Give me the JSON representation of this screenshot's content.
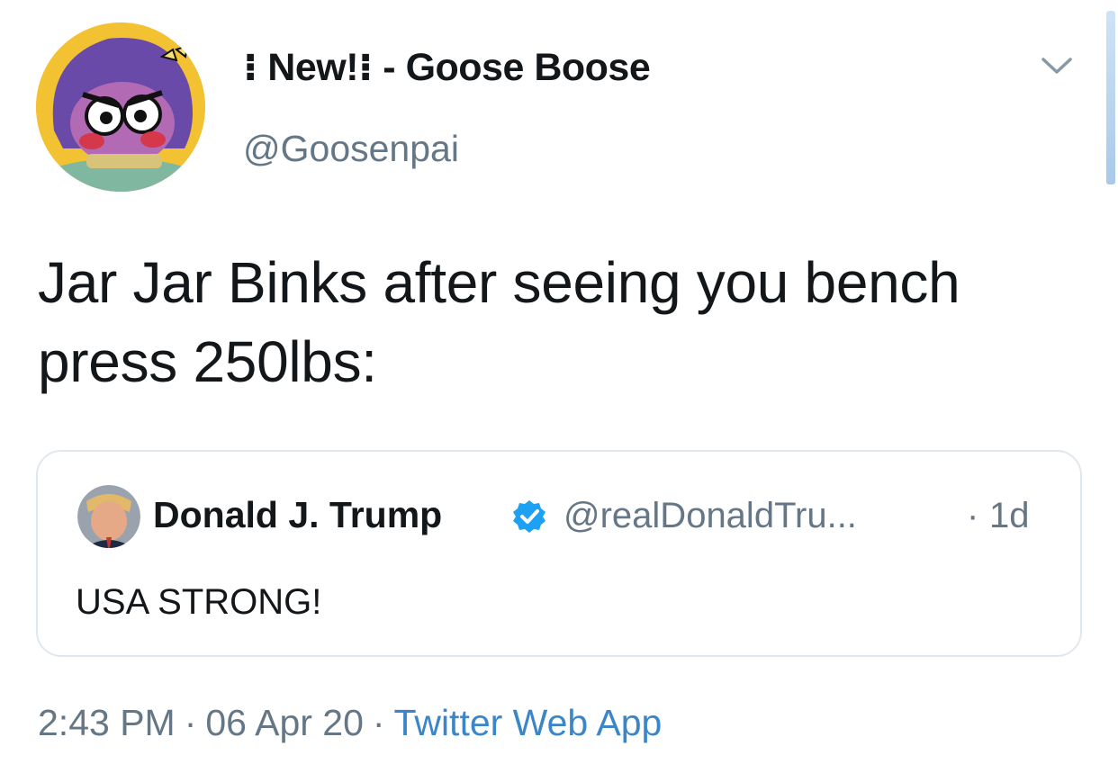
{
  "author": {
    "display_name": "⁝ New!⁝ - Goose Boose",
    "handle": "@Goosenpai"
  },
  "tweet": {
    "text": "Jar Jar Binks after seeing you bench press 250lbs:"
  },
  "quoted_tweet": {
    "display_name": "Donald J. Trump",
    "handle": "@realDonaldTru...",
    "separator": "·",
    "time": "1d",
    "text": "USA STRONG!"
  },
  "meta": {
    "time": "2:43 PM",
    "separator": "·",
    "date": "06 Apr 20",
    "source": "Twitter Web App"
  },
  "icons": {
    "menu": "chevron-down-icon",
    "verified": "verified-badge-icon"
  },
  "colors": {
    "text": "#14171a",
    "secondary": "#657786",
    "link": "#3a86c8",
    "border": "#e1e8ed",
    "verified": "#1da1f2"
  }
}
